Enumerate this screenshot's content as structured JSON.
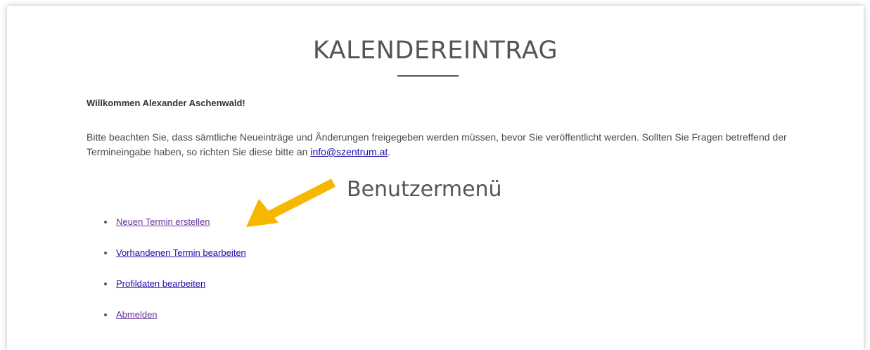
{
  "page": {
    "title": "KALENDEREINTRAG",
    "welcome": "Willkommen Alexander Aschenwald!",
    "intro_text": "Bitte beachten Sie, dass sämtliche Neueinträge und Änderungen freigegeben werden müssen, bevor Sie veröffentlicht werden. Sollten Sie Fragen betreffend der Termineingabe haben, so richten Sie diese bitte an ",
    "intro_email": "info@szentrum.at",
    "intro_end": "."
  },
  "menu": {
    "title": "Benutzermenü",
    "items": [
      {
        "label": "Neuen Termin erstellen",
        "color": "#663399"
      },
      {
        "label": "Vorhandenen Termin bearbeiten",
        "color": "#1a0dab"
      },
      {
        "label": "Profildaten bearbeiten",
        "color": "#1a0dab"
      },
      {
        "label": "Abmelden",
        "color": "#663399"
      }
    ]
  },
  "colors": {
    "arrow": "#f5b700",
    "link": "#1a0dab",
    "visited_link": "#663399",
    "heading": "#555555"
  },
  "icons": {
    "annotation": "arrow-pointing-left-icon",
    "list_marker": "bullet-icon"
  }
}
